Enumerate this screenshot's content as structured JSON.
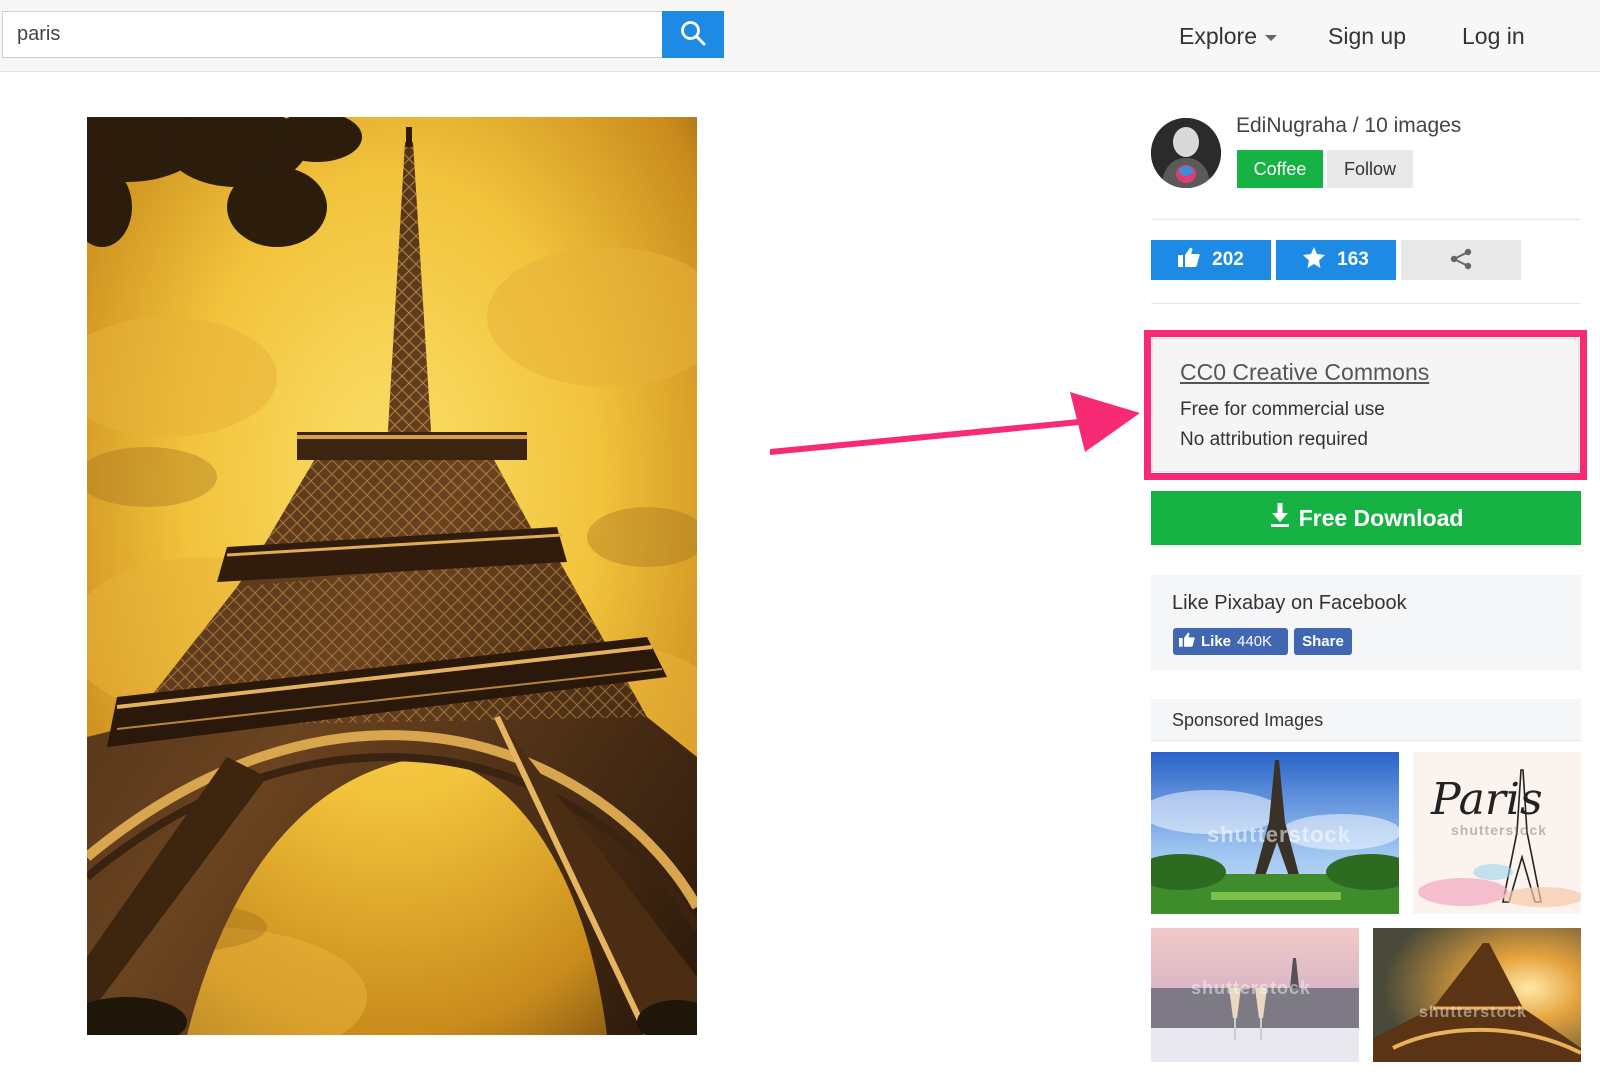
{
  "search": {
    "value": "paris"
  },
  "nav": {
    "explore": "Explore",
    "signup": "Sign up",
    "login": "Log in"
  },
  "author": {
    "name_line": "EdiNugraha / 10 images",
    "coffee": "Coffee",
    "follow": "Follow"
  },
  "stats": {
    "likes": "202",
    "favorites": "163"
  },
  "license": {
    "title": "CC0 Creative Commons",
    "line1": "Free for commercial use",
    "line2": "No attribution required"
  },
  "download": {
    "label": "Free Download"
  },
  "facebook": {
    "title": "Like Pixabay on Facebook",
    "like": "Like",
    "count": "440K",
    "share": "Share"
  },
  "sponsored": {
    "title": "Sponsored Images",
    "watermark": "shutterstock",
    "paris_script": "Paris"
  },
  "colors": {
    "accent_blue": "#1d8be4",
    "green": "#17b244",
    "highlight_pink": "#f72a75",
    "facebook_blue": "#4267b2"
  }
}
